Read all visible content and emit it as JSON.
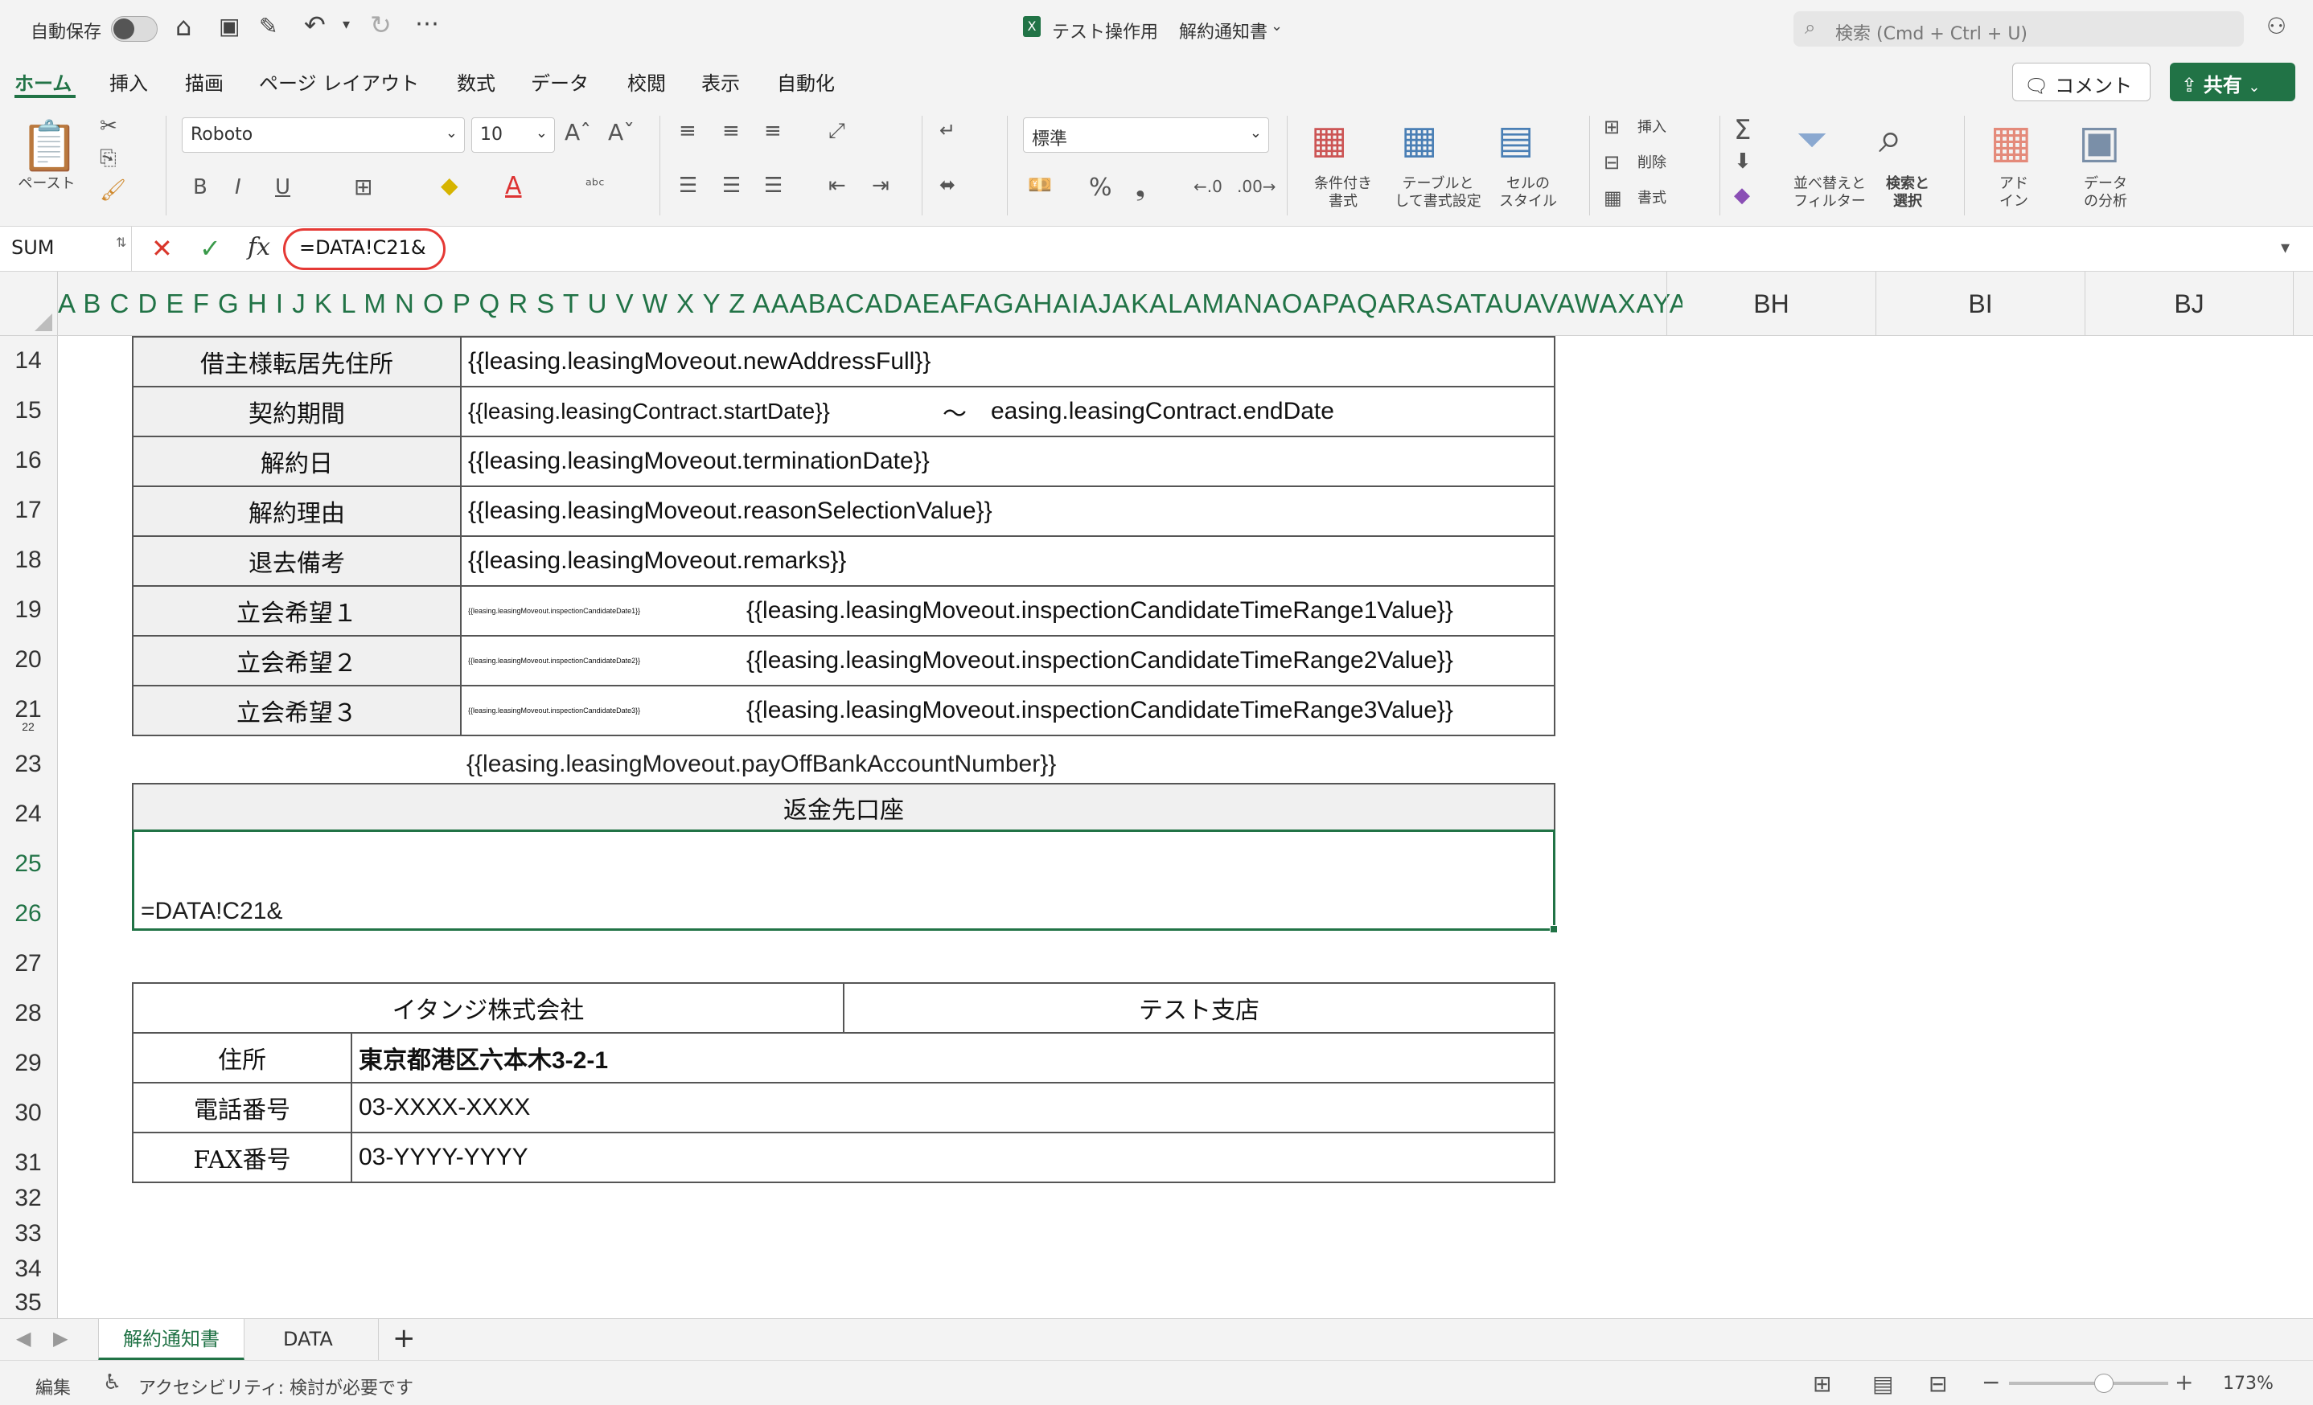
{
  "titlebar": {
    "autosave_label": "自動保存",
    "file_name": "テスト操作用",
    "doc_title": "解約通知書",
    "search_placeholder": "検索 (Cmd + Ctrl + U)"
  },
  "ribbon_tabs": [
    "ホーム",
    "挿入",
    "描画",
    "ページ レイアウト",
    "数式",
    "データ",
    "校閲",
    "表示",
    "自動化"
  ],
  "actions": {
    "comment_label": "コメント",
    "share_label": "共有"
  },
  "ribbon": {
    "paste_label": "ペースト",
    "font_name": "Roboto",
    "font_size": "10",
    "number_format": "標準",
    "bold": "B",
    "italic": "I",
    "underline": "U",
    "conditional_format": "条件付き\n書式",
    "table_format": "テーブルと\nして書式設定",
    "cell_style": "セルの\nスタイル",
    "insert": "挿入",
    "delete": "削除",
    "format": "書式",
    "sort_filter": "並べ替えと\nフィルター",
    "find_select": "検索と\n選択",
    "addin": "アド\nイン",
    "analyze": "データ\nの分析"
  },
  "formula_bar": {
    "name_box": "SUM",
    "fx": "fx",
    "formula": "=DATA!C21&"
  },
  "column_headers": {
    "narrow": "A B C D E F G H I J K L M N O P Q R S T U V W X Y Z AAABACADAEAFAGAHAIAJAKALAMANAOAPAQARASATAUAVAWAXAYAZBABBBCBDBEBFBG",
    "wide": [
      "BH",
      "BI",
      "BJ"
    ]
  },
  "rows": [
    "14",
    "15",
    "16",
    "17",
    "18",
    "19",
    "20",
    "21",
    "22",
    "23",
    "24",
    "25",
    "26",
    "27",
    "28",
    "29",
    "30",
    "31",
    "32",
    "33",
    "34",
    "35"
  ],
  "form": {
    "r14": {
      "label": "借主様転居先住所",
      "value": "{{leasing.leasingMoveout.newAddressFull}}"
    },
    "r15": {
      "label": "契約期間",
      "start": "{{leasing.leasingContract.startDate}}",
      "tilde": "〜",
      "end": "easing.leasingContract.endDate"
    },
    "r16": {
      "label": "解約日",
      "value": "{{leasing.leasingMoveout.terminationDate}}"
    },
    "r17": {
      "label": "解約理由",
      "value": "{{leasing.leasingMoveout.reasonSelectionValue}}"
    },
    "r18": {
      "label": "退去備考",
      "value": "{{leasing.leasingMoveout.remarks}}"
    },
    "r19": {
      "label": "立会希望１",
      "date": "{{leasing.leasingMoveout.inspectionCandidateDate1}}",
      "value": "{{leasing.leasingMoveout.inspectionCandidateTimeRange1Value}}"
    },
    "r20": {
      "label": "立会希望２",
      "date": "{{leasing.leasingMoveout.inspectionCandidateDate2}}",
      "value": "{{leasing.leasingMoveout.inspectionCandidateTimeRange2Value}}"
    },
    "r21": {
      "label": "立会希望３",
      "date": "{{leasing.leasingMoveout.inspectionCandidateDate3}}",
      "value": "{{leasing.leasingMoveout.inspectionCandidateTimeRange3Value}}"
    },
    "r23": {
      "value": "{{leasing.leasingMoveout.payOffBankAccountNumber}}"
    },
    "r24": {
      "label": "返金先口座"
    },
    "r26": {
      "value": "=DATA!C21&"
    }
  },
  "company": {
    "name": "イタンジ株式会社",
    "branch": "テスト支店",
    "address_label": "住所",
    "address": "東京都港区六本木3-2-1",
    "phone_label": "電話番号",
    "phone": "03-XXXX-XXXX",
    "fax_label": "FAX番号",
    "fax": "03-YYYY-YYYY"
  },
  "sheet_tabs": [
    "解約通知書",
    "DATA"
  ],
  "status": {
    "mode": "編集",
    "accessibility": "アクセシビリティ: 検討が必要です",
    "zoom": "173%"
  },
  "colors": {
    "accent": "#217346",
    "selection_border": "#217346",
    "highlight_circle": "#e53935"
  }
}
